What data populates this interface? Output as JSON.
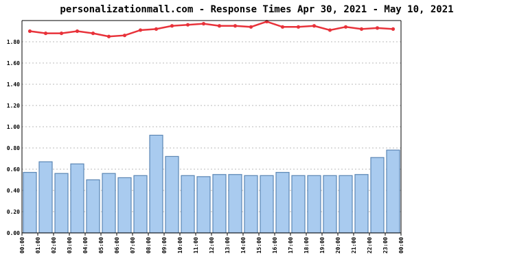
{
  "chart_data": {
    "type": "bar",
    "title": "personalizationmall.com - Response Times Apr 30, 2021 - May 10, 2021",
    "xlabel": "",
    "ylabel": "",
    "ylim": [
      0,
      2.0
    ],
    "yticks": [
      "0.00",
      "0.20",
      "0.40",
      "0.60",
      "0.80",
      "1.00",
      "1.20",
      "1.40",
      "1.60",
      "1.80"
    ],
    "categories": [
      "00:00",
      "01:00",
      "02:00",
      "03:00",
      "04:00",
      "05:00",
      "06:00",
      "07:00",
      "08:00",
      "09:00",
      "10:00",
      "11:00",
      "12:00",
      "13:00",
      "14:00",
      "15:00",
      "16:00",
      "17:00",
      "18:00",
      "19:00",
      "20:00",
      "21:00",
      "22:00",
      "23:00",
      "00:00"
    ],
    "series": [
      {
        "type": "bar",
        "color": "#a9cbef",
        "values": [
          0.57,
          0.67,
          0.56,
          0.65,
          0.5,
          0.56,
          0.52,
          0.54,
          0.92,
          0.72,
          0.54,
          0.53,
          0.55,
          0.55,
          0.54,
          0.54,
          0.57,
          0.54,
          0.54,
          0.54,
          0.54,
          0.55,
          0.71,
          0.78
        ]
      },
      {
        "type": "line",
        "color": "#e8323a",
        "values": [
          1.9,
          1.88,
          1.88,
          1.9,
          1.88,
          1.85,
          1.86,
          1.91,
          1.92,
          1.95,
          1.96,
          1.97,
          1.95,
          1.95,
          1.94,
          1.99,
          1.94,
          1.94,
          1.95,
          1.91,
          1.94,
          1.92,
          1.93,
          1.92
        ]
      }
    ],
    "grid": true,
    "legend": "none"
  }
}
